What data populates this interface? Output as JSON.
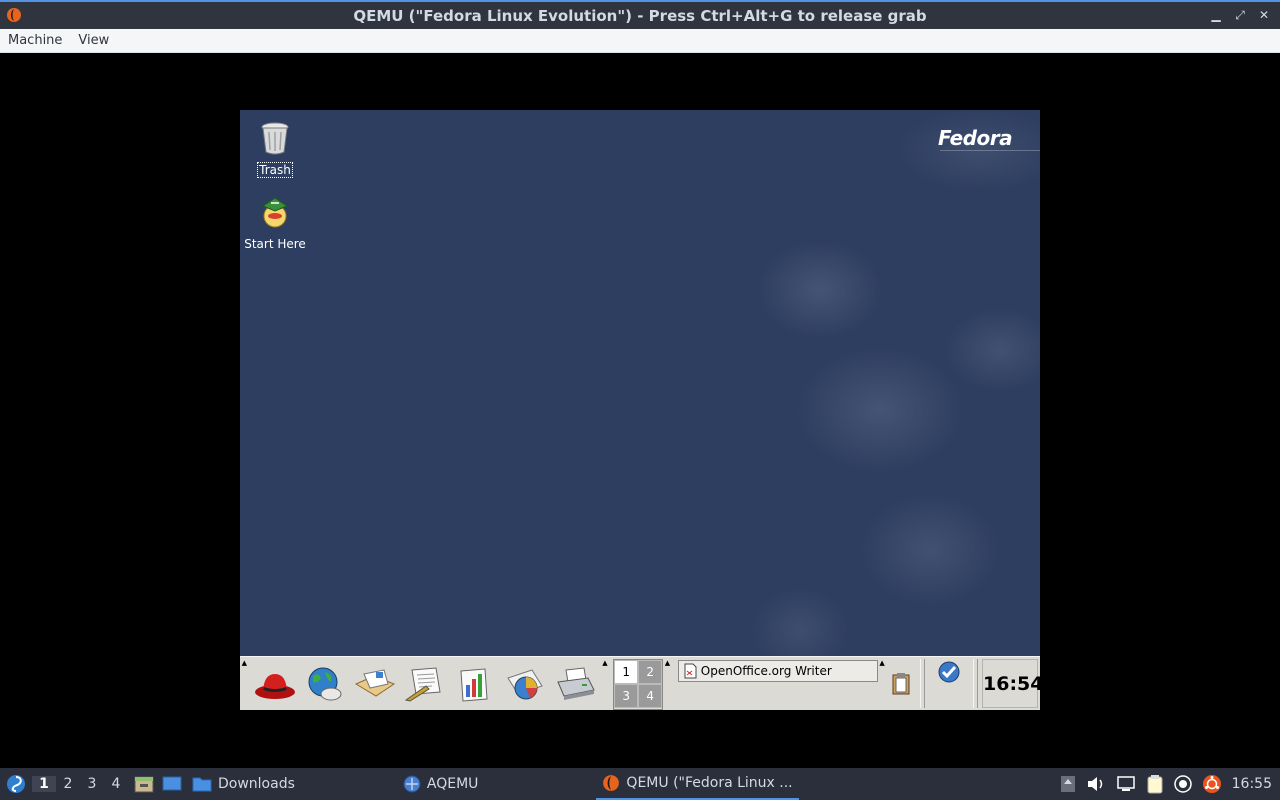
{
  "window": {
    "title": "QEMU (\"Fedora Linux Evolution\") - Press Ctrl+Alt+G to release grab",
    "icon": "qemu-icon",
    "buttons": [
      "minimize",
      "maximize",
      "close"
    ]
  },
  "menubar": {
    "items": [
      "Machine",
      "View"
    ]
  },
  "guest": {
    "logo_text": "Fedora",
    "desktop_icons": [
      {
        "label": "Trash",
        "icon": "trash-icon",
        "selected": true
      },
      {
        "label": "Start Here",
        "icon": "start-here-icon",
        "selected": false
      }
    ],
    "panel": {
      "launchers": [
        "main-menu-hat-icon",
        "web-browser-icon",
        "email-icon",
        "writer-icon",
        "calc-icon",
        "impress-icon",
        "print-manager-icon"
      ],
      "workspaces": [
        "1",
        "2",
        "3",
        "4"
      ],
      "active_workspace": "1",
      "task": {
        "label": "OpenOffice.org Writer",
        "icon": "writer-doc-icon"
      },
      "clock": "16:54"
    }
  },
  "hostbar": {
    "workspaces": [
      "1",
      "2",
      "3",
      "4"
    ],
    "active_workspace": "1",
    "windows": [
      {
        "label": "Downloads",
        "icon": "folder-icon"
      },
      {
        "label": "AQEMU",
        "icon": "aqemu-icon"
      },
      {
        "label": "QEMU (\"Fedora Linux ...",
        "icon": "qemu-icon"
      }
    ],
    "clock": "16:55"
  },
  "colors": {
    "accent": "#5294e2",
    "desktop_bg": "#2e3e60",
    "panel_bg": "#dcdad5",
    "host_bar_bg": "#2b2f3b"
  }
}
